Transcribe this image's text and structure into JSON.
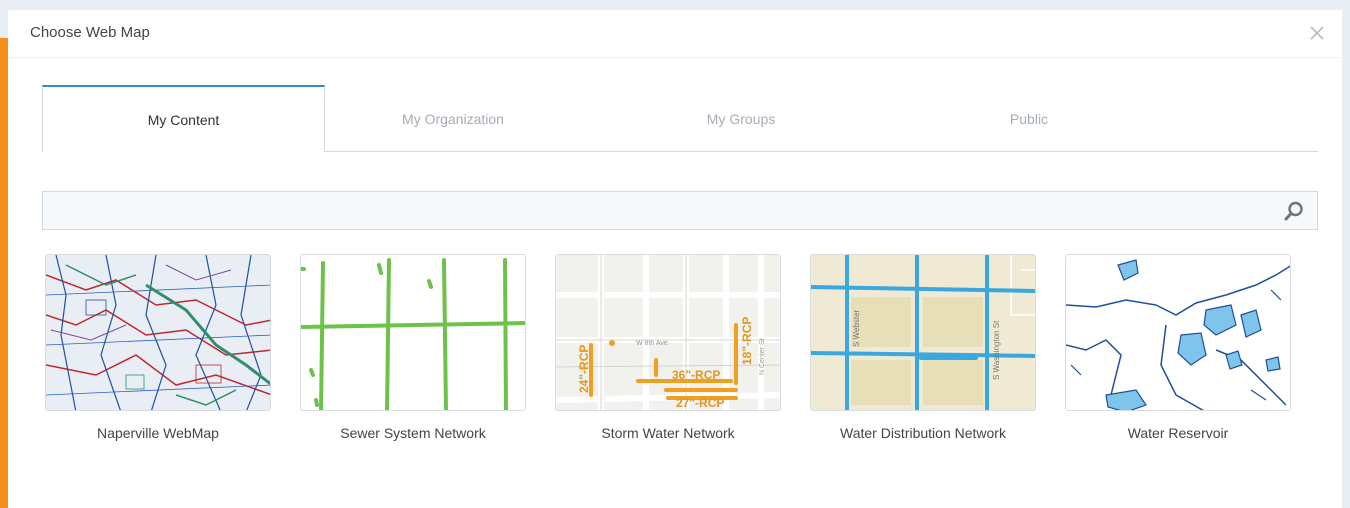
{
  "dialog": {
    "title": "Choose Web Map"
  },
  "tabs": [
    {
      "label": "My Content",
      "active": true
    },
    {
      "label": "My Organization",
      "active": false
    },
    {
      "label": "My Groups",
      "active": false
    },
    {
      "label": "Public",
      "active": false
    }
  ],
  "search": {
    "value": "",
    "icon": "search-icon"
  },
  "maps": [
    {
      "title": "Naperville WebMap",
      "thumbnail": "multicolor-network-map"
    },
    {
      "title": "Sewer System Network",
      "thumbnail": "green-sewer-lines"
    },
    {
      "title": "Storm Water Network",
      "thumbnail": "orange-storm-pipes",
      "labels": {
        "pipe1": "24\"-RCP",
        "pipe2": "36\"-RCP",
        "pipe3": "27\"-RCP",
        "pipe4": "18\"-RCP",
        "street1": "W 8th Ave",
        "street2": "N Center St"
      }
    },
    {
      "title": "Water Distribution Network",
      "thumbnail": "blue-water-mains",
      "labels": {
        "street1": "S Webster",
        "street2": "S Washington St"
      }
    },
    {
      "title": "Water Reservoir",
      "thumbnail": "blue-reservoir-outlines"
    }
  ],
  "colors": {
    "accent_tab": "#2f8ad6",
    "sidebar_strip": "#f28f1c",
    "sewer": "#6cc24a",
    "storm": "#f0a020",
    "water": "#3aa7e0",
    "reservoir": "#1f4f9c"
  }
}
